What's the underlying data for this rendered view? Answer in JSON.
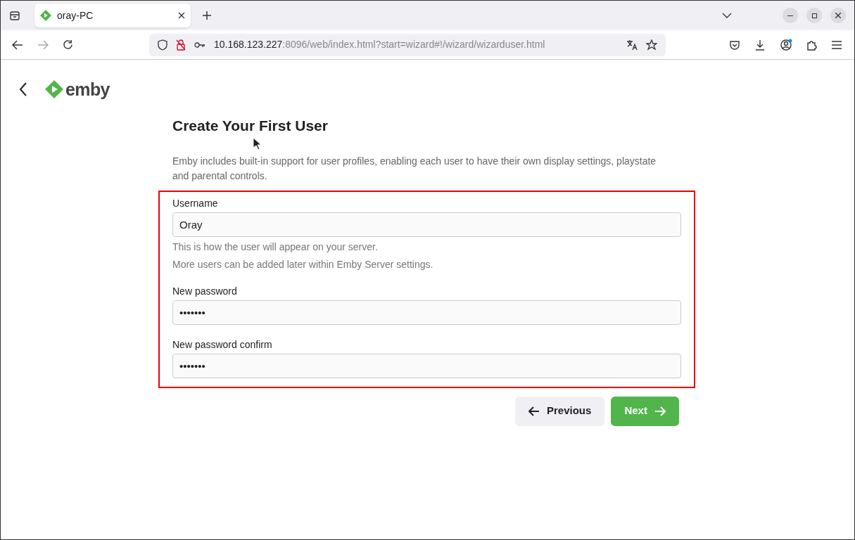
{
  "browser": {
    "tab": {
      "title": "oray-PC",
      "selected": true
    },
    "address": {
      "host": "10.168.123.227",
      "path": ":8096/web/index.html?start=wizard#!/wizard/wizarduser.html"
    }
  },
  "app": {
    "logo_text": "emby"
  },
  "page": {
    "title": "Create Your First User",
    "intro": "Emby includes built-in support for user profiles, enabling each user to have their own display settings, playstate and parental controls.",
    "fields": [
      {
        "label": "Username",
        "value": "Oray",
        "help": [
          "This is how the user will appear on your server.",
          "More users can be added later within Emby Server settings."
        ]
      },
      {
        "label": "New password",
        "value": "•••••••"
      },
      {
        "label": "New password confirm",
        "value": "•••••••"
      }
    ],
    "buttons": [
      {
        "label": "Previous",
        "kind": "secondary"
      },
      {
        "label": "Next",
        "kind": "primary"
      }
    ]
  }
}
